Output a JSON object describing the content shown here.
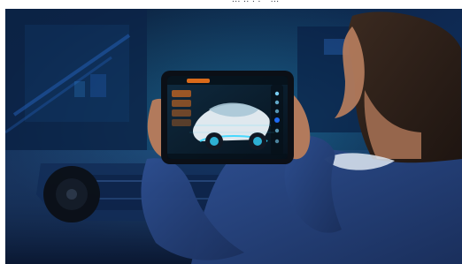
{
  "scene": {
    "top_strip_text": "... .. . .-- ...",
    "colors": {
      "background_dark": "#0a1730",
      "accent_cyan": "#36d6ff",
      "accent_blue": "#1f6fff",
      "jacket": "#203a73",
      "skin": "#b27a5c"
    },
    "tablet": {
      "app_panel_labels": [
        "",
        "",
        "",
        ""
      ]
    }
  }
}
